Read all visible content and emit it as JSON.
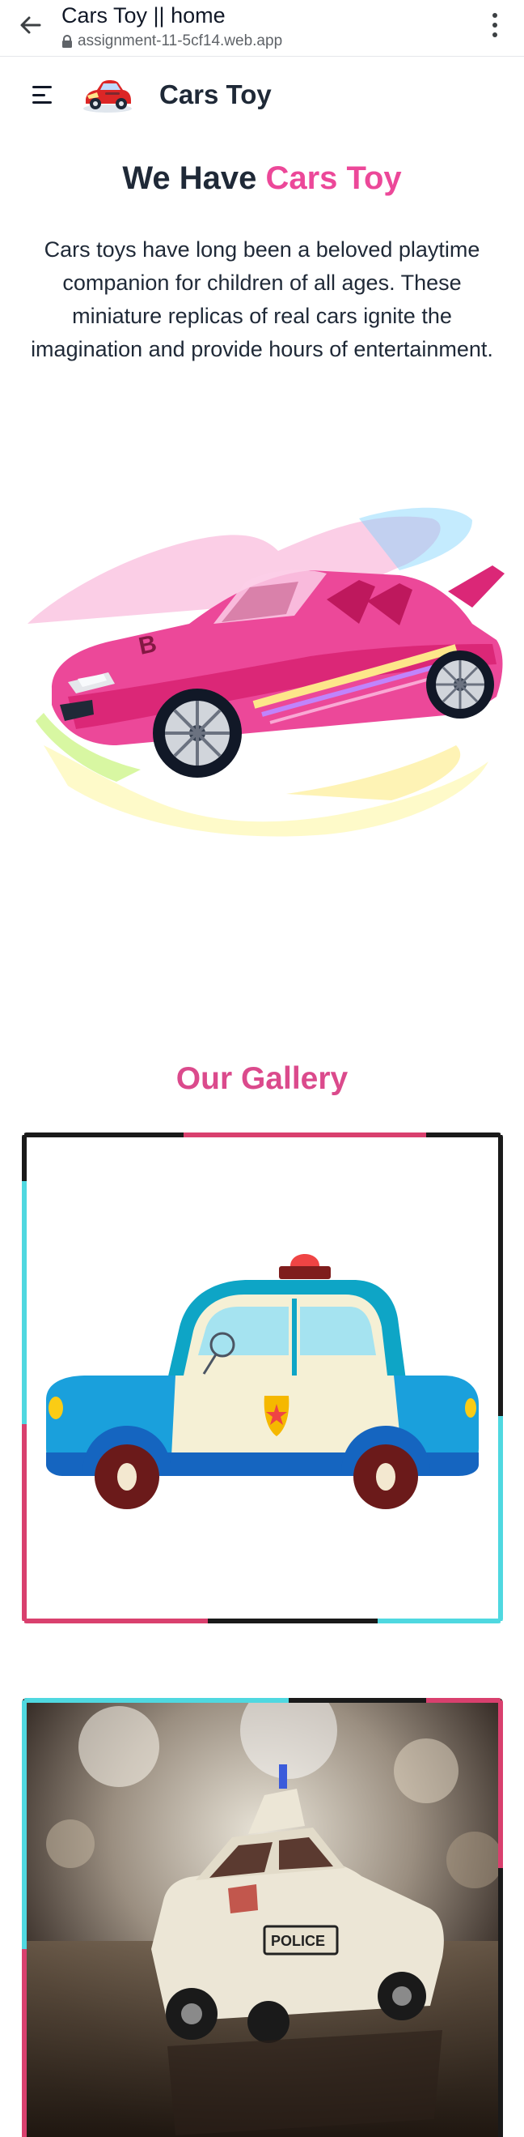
{
  "browser": {
    "page_title": "Cars Toy || home",
    "url": "assignment-11-5cf14.web.app"
  },
  "navbar": {
    "brand": "Cars Toy"
  },
  "hero": {
    "title_prefix": "We Have",
    "title_accent": "Cars Toy",
    "description": "Cars toys have long been a beloved playtime companion for children of all ages. These miniature replicas of real cars ignite the imagination and provide hours of entertainment."
  },
  "gallery": {
    "title": "Our Gallery"
  },
  "icons": {
    "back": "arrow-left-icon",
    "lock": "lock-icon",
    "menu": "more-vertical-icon",
    "hamburger": "hamburger-menu-icon"
  },
  "colors": {
    "accent": "#ec4899",
    "gallery_title": "#db4a8c",
    "heading": "#1f2937",
    "border_cyan": "#4fd8e0",
    "border_pink": "#d9406e",
    "border_dark": "#1a1a1a"
  }
}
